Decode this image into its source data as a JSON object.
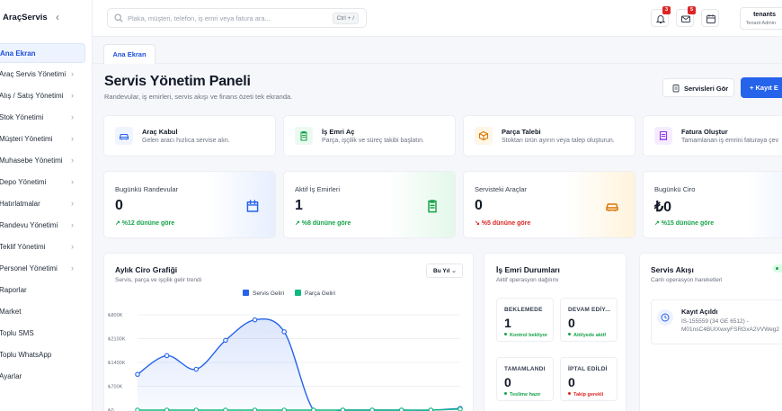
{
  "app": {
    "brand": "AraçServis"
  },
  "sidebar": {
    "items": [
      {
        "label": "Ana Ekran"
      },
      {
        "label": "Araç Servis Yönetimi"
      },
      {
        "label": "Alış / Satış Yönetimi"
      },
      {
        "label": "Stok Yönetimi"
      },
      {
        "label": "Müşteri Yönetimi"
      },
      {
        "label": "Muhasebe Yönetimi"
      },
      {
        "label": "Depo Yönetimi"
      },
      {
        "label": "Hatırlatmalar"
      },
      {
        "label": "Randevu Yönetimi"
      },
      {
        "label": "Teklif Yönetimi"
      },
      {
        "label": "Personel Yönetimi"
      },
      {
        "label": "Raporlar"
      },
      {
        "label": "Market"
      },
      {
        "label": "Toplu SMS"
      },
      {
        "label": "Toplu WhatsApp"
      },
      {
        "label": "Ayarlar"
      }
    ]
  },
  "header": {
    "search_placeholder": "Plaka, müşteri, telefon, iş emri veya fatura ara...",
    "search_shortcut": "Ctrl + /",
    "notifications_count": "3",
    "messages_count": "5",
    "user_name": "tenants",
    "user_role": "Tenant Admin"
  },
  "tabs": [
    {
      "label": "Ana Ekran"
    }
  ],
  "page": {
    "title": "Servis Yönetim Paneli",
    "subtitle": "Randevular, iş emirleri, servis akışı ve finans özeti tek ekranda.",
    "btn_secondary": "Servisleri Gör",
    "btn_primary": "+ Kayıt E"
  },
  "quick_actions": [
    {
      "title": "Araç Kabul",
      "desc": "Gelen aracı hızlıca servise alın.",
      "icon": "car-icon",
      "color": "#2563eb",
      "bg": "#eff4ff"
    },
    {
      "title": "İş Emri Aç",
      "desc": "Parça, işçilik ve süreç takibi başlatın.",
      "icon": "clipboard-icon",
      "color": "#16a34a",
      "bg": "#eafaf0"
    },
    {
      "title": "Parça Talebi",
      "desc": "Stoktan ürün ayırın veya talep oluşturun.",
      "icon": "box-icon",
      "color": "#d97706",
      "bg": "#fff6e6"
    },
    {
      "title": "Fatura Oluştur",
      "desc": "Tamamlanan iş emrini faturaya çev",
      "icon": "invoice-icon",
      "color": "#9333ea",
      "bg": "#f5edff"
    }
  ],
  "kpis": [
    {
      "title": "Bugünkü Randevular",
      "value": "0",
      "change": "↗ %12 dününe göre",
      "change_color": "#16a34a",
      "icon": "calendar-icon",
      "accent": "#2563eb",
      "glow": "#e7efff"
    },
    {
      "title": "Aktif İş Emirleri",
      "value": "1",
      "change": "↗ %8 dününe göre",
      "change_color": "#16a34a",
      "icon": "clipboard-icon",
      "accent": "#16a34a",
      "glow": "#e3f8ea"
    },
    {
      "title": "Servisteki Araçlar",
      "value": "0",
      "change": "↘ %5 dününe göre",
      "change_color": "#dc2626",
      "icon": "car-icon",
      "accent": "#d97706",
      "glow": "#fff3dc"
    },
    {
      "title": "Bugünkü Ciro",
      "value": "₺0",
      "change": "↗ %15 dününe göre",
      "change_color": "#16a34a",
      "icon": "wallet-icon",
      "accent": "#2563eb",
      "glow": "#e7efff"
    }
  ],
  "revenue_panel": {
    "title": "Aylık Ciro Grafiği",
    "subtitle": "Servis, parça ve işçilik gelir trendi",
    "period": "Bu Yıl"
  },
  "chart_data": {
    "type": "line",
    "title": "Aylık Ciro Grafiği",
    "y_tick_labels": [
      "₺800K",
      "₺2100K",
      "₺1400K",
      "₺700K",
      "₺0"
    ],
    "y_ticks": [
      2800,
      2100,
      1400,
      700,
      0
    ],
    "ylim": [
      0,
      2800
    ],
    "x": [
      1,
      2,
      3,
      4,
      5,
      6,
      7,
      8,
      9,
      10,
      11,
      12
    ],
    "series": [
      {
        "name": "Servis Geliri",
        "color": "#2563eb",
        "values": [
          1050,
          1600,
          1200,
          2050,
          2650,
          2300,
          0,
          0,
          0,
          0,
          0,
          50
        ]
      },
      {
        "name": "Parça Geliri",
        "color": "#10b981",
        "values": [
          0,
          0,
          0,
          0,
          0,
          0,
          0,
          0,
          0,
          0,
          0,
          30
        ]
      }
    ],
    "legend_position": "top",
    "grid": true
  },
  "status_panel": {
    "title": "İş Emri Durumları",
    "subtitle": "Aktif operasyon dağılımı",
    "boxes": [
      {
        "label": "BEKLEMEDE",
        "value": "1",
        "note": "Kontrol bekliyor",
        "color": "#16a34a"
      },
      {
        "label": "DEVAM EDİY...",
        "value": "0",
        "note": "Atölyede aktif",
        "color": "#16a34a"
      },
      {
        "label": "TAMAMLANDI",
        "value": "0",
        "note": "Teslime hazır",
        "color": "#16a34a"
      },
      {
        "label": "İPTAL EDİLDİ",
        "value": "0",
        "note": "Takip gerekli",
        "color": "#dc2626"
      }
    ]
  },
  "flow_panel": {
    "title": "Servis Akışı",
    "subtitle": "Canlı operasyon hareketleri",
    "items": [
      {
        "title": "Kayıt Açıldı",
        "text": "IS-155559 (34 GE 6512) - M01nsC4BUIXwxyFSRGxA2VVWeg2"
      }
    ]
  }
}
